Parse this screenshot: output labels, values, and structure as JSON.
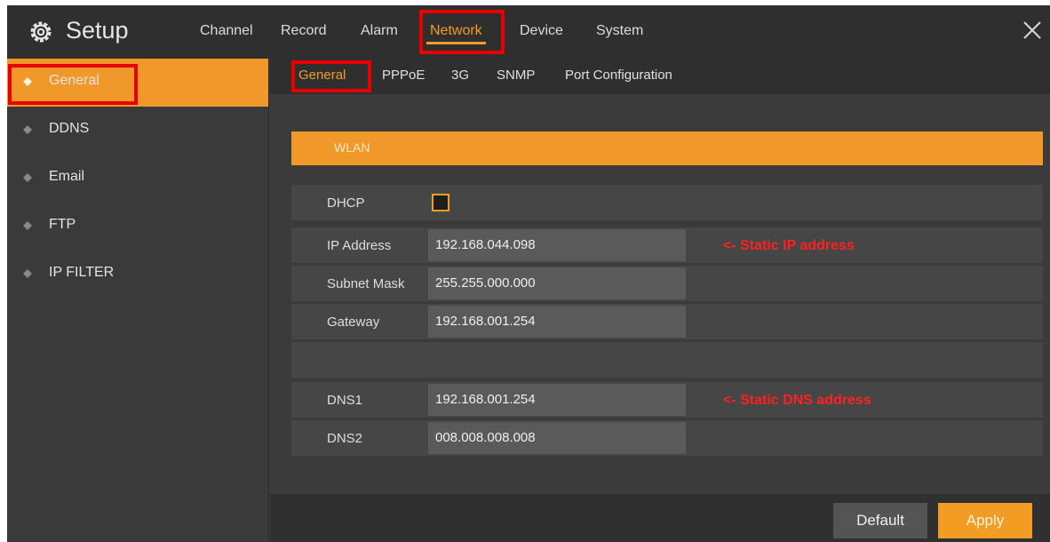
{
  "app": {
    "title": "Setup"
  },
  "nav": {
    "items": [
      {
        "label": "Channel"
      },
      {
        "label": "Record"
      },
      {
        "label": "Alarm"
      },
      {
        "label": "Network",
        "active": true
      },
      {
        "label": "Device"
      },
      {
        "label": "System"
      }
    ],
    "close_icon": "close-icon"
  },
  "sidebar": {
    "items": [
      {
        "label": "General",
        "active": true
      },
      {
        "label": "DDNS"
      },
      {
        "label": "Email"
      },
      {
        "label": "FTP"
      },
      {
        "label": "IP FILTER"
      }
    ]
  },
  "subtabs": [
    {
      "label": "General",
      "active": true
    },
    {
      "label": "PPPoE"
    },
    {
      "label": "3G"
    },
    {
      "label": "SNMP"
    },
    {
      "label": "Port Configuration"
    }
  ],
  "section": {
    "title": "WLAN"
  },
  "form": {
    "dhcp": {
      "label": "DHCP",
      "checked": false
    },
    "ip": {
      "label": "IP Address",
      "value": "192.168.044.098"
    },
    "subnet": {
      "label": "Subnet Mask",
      "value": "255.255.000.000"
    },
    "gateway": {
      "label": "Gateway",
      "value": "192.168.001.254"
    },
    "dns1": {
      "label": "DNS1",
      "value": "192.168.001.254"
    },
    "dns2": {
      "label": "DNS2",
      "value": "008.008.008.008"
    }
  },
  "annotations": {
    "ip": "<- Static IP address",
    "dns": "<- Static DNS address"
  },
  "buttons": {
    "default_label": "Default",
    "apply_label": "Apply"
  },
  "colors": {
    "accent": "#f39c24",
    "highlight_box": "#e80000",
    "annotation_text": "#ff2020"
  }
}
